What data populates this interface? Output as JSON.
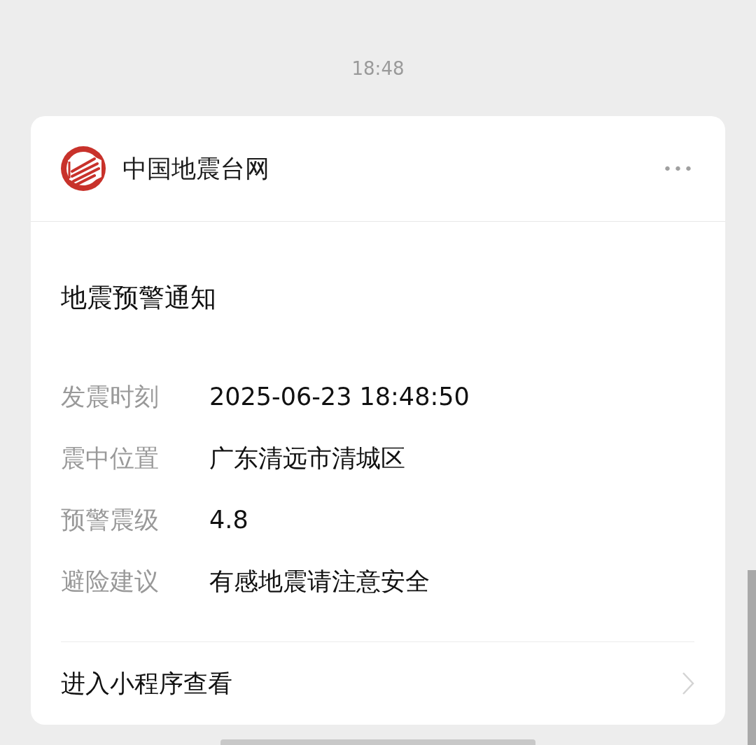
{
  "time": "18:48",
  "account": {
    "name": "中国地震台网",
    "more": "•••"
  },
  "notice": {
    "title": "地震预警通知",
    "fields": [
      {
        "label": "发震时刻",
        "value": "2025-06-23 18:48:50"
      },
      {
        "label": "震中位置",
        "value": "广东清远市清城区"
      },
      {
        "label": "预警震级",
        "value": "4.8"
      },
      {
        "label": "避险建议",
        "value": "有感地震请注意安全"
      }
    ],
    "link": "进入小程序查看"
  }
}
